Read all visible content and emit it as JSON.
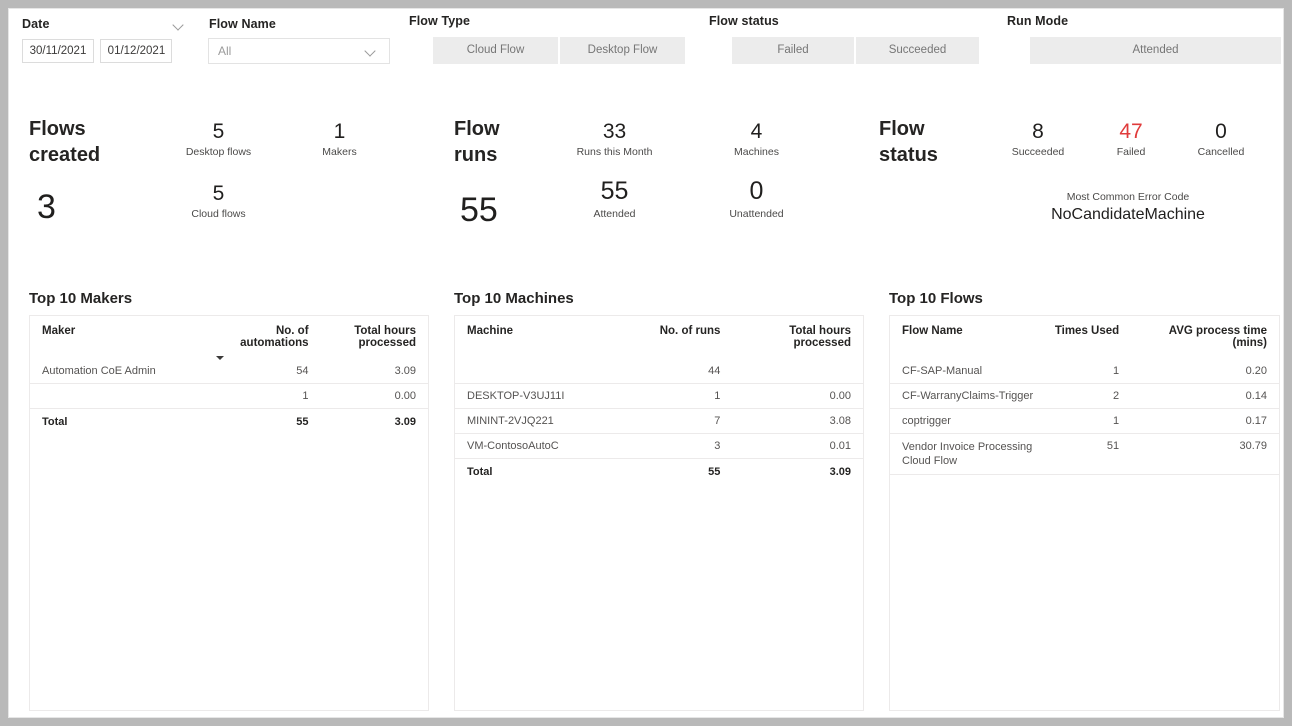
{
  "filters": {
    "date": {
      "label": "Date",
      "chevron_icon": "chevron-down-icon",
      "start": "30/11/2021",
      "end": "01/12/2021"
    },
    "flow_name": {
      "label": "Flow Name",
      "value": "All",
      "placeholder": "All",
      "chevron_icon": "chevron-down-icon"
    },
    "flow_type": {
      "label": "Flow Type",
      "options": [
        "Cloud Flow",
        "Desktop Flow"
      ]
    },
    "flow_status": {
      "label": "Flow status",
      "options": [
        "Failed",
        "Succeeded"
      ]
    },
    "run_mode": {
      "label": "Run Mode",
      "options": [
        "Attended"
      ]
    }
  },
  "kpis": {
    "flows_created": {
      "title_line1": "Flows",
      "title_line2": "created",
      "total": "3",
      "metrics": [
        {
          "value": "5",
          "caption": "Desktop flows"
        },
        {
          "value": "5",
          "caption": "Cloud flows"
        },
        {
          "value": "1",
          "caption": "Makers"
        }
      ]
    },
    "flow_runs": {
      "title_line1": "Flow",
      "title_line2": "runs",
      "total": "55",
      "metrics": [
        {
          "value": "33",
          "caption": "Runs this Month"
        },
        {
          "value": "55",
          "caption": "Attended"
        },
        {
          "value": "4",
          "caption": "Machines"
        },
        {
          "value": "0",
          "caption": "Unattended"
        }
      ]
    },
    "flow_status": {
      "title_line1": "Flow",
      "title_line2": "status",
      "metrics": [
        {
          "value": "8",
          "caption": "Succeeded",
          "color": "#201f1e"
        },
        {
          "value": "47",
          "caption": "Failed",
          "color": "#e03b3b"
        },
        {
          "value": "0",
          "caption": "Cancelled",
          "color": "#201f1e"
        }
      ],
      "error_caption": "Most Common Error Code",
      "error_value": "NoCandidateMachine"
    }
  },
  "tables": {
    "makers": {
      "title": "Top 10 Makers",
      "columns": [
        "Maker",
        "No. of automations",
        "Total hours processed"
      ],
      "sorted_column_index": 1,
      "sort_direction": "desc",
      "rows": [
        [
          "Automation CoE Admin",
          "54",
          "3.09"
        ],
        [
          "",
          "1",
          "0.00"
        ]
      ],
      "total": [
        "Total",
        "55",
        "3.09"
      ]
    },
    "machines": {
      "title": "Top 10 Machines",
      "columns": [
        "Machine",
        "No. of runs",
        "Total hours processed"
      ],
      "rows": [
        [
          "",
          "44",
          ""
        ],
        [
          "DESKTOP-V3UJ11I",
          "1",
          "0.00"
        ],
        [
          "MININT-2VJQ221",
          "7",
          "3.08"
        ],
        [
          "VM-ContosoAutoC",
          "3",
          "0.01"
        ]
      ],
      "total": [
        "Total",
        "55",
        "3.09"
      ]
    },
    "flows": {
      "title": "Top 10 Flows",
      "columns": [
        "Flow Name",
        "Times Used",
        "AVG process time (mins)"
      ],
      "rows": [
        [
          "CF-SAP-Manual",
          "1",
          "0.20"
        ],
        [
          "CF-WarranyClaims-Trigger",
          "2",
          "0.14"
        ],
        [
          "coptrigger",
          "1",
          "0.17"
        ],
        [
          "Vendor Invoice Processing Cloud Flow",
          "51",
          "30.79"
        ]
      ]
    }
  }
}
